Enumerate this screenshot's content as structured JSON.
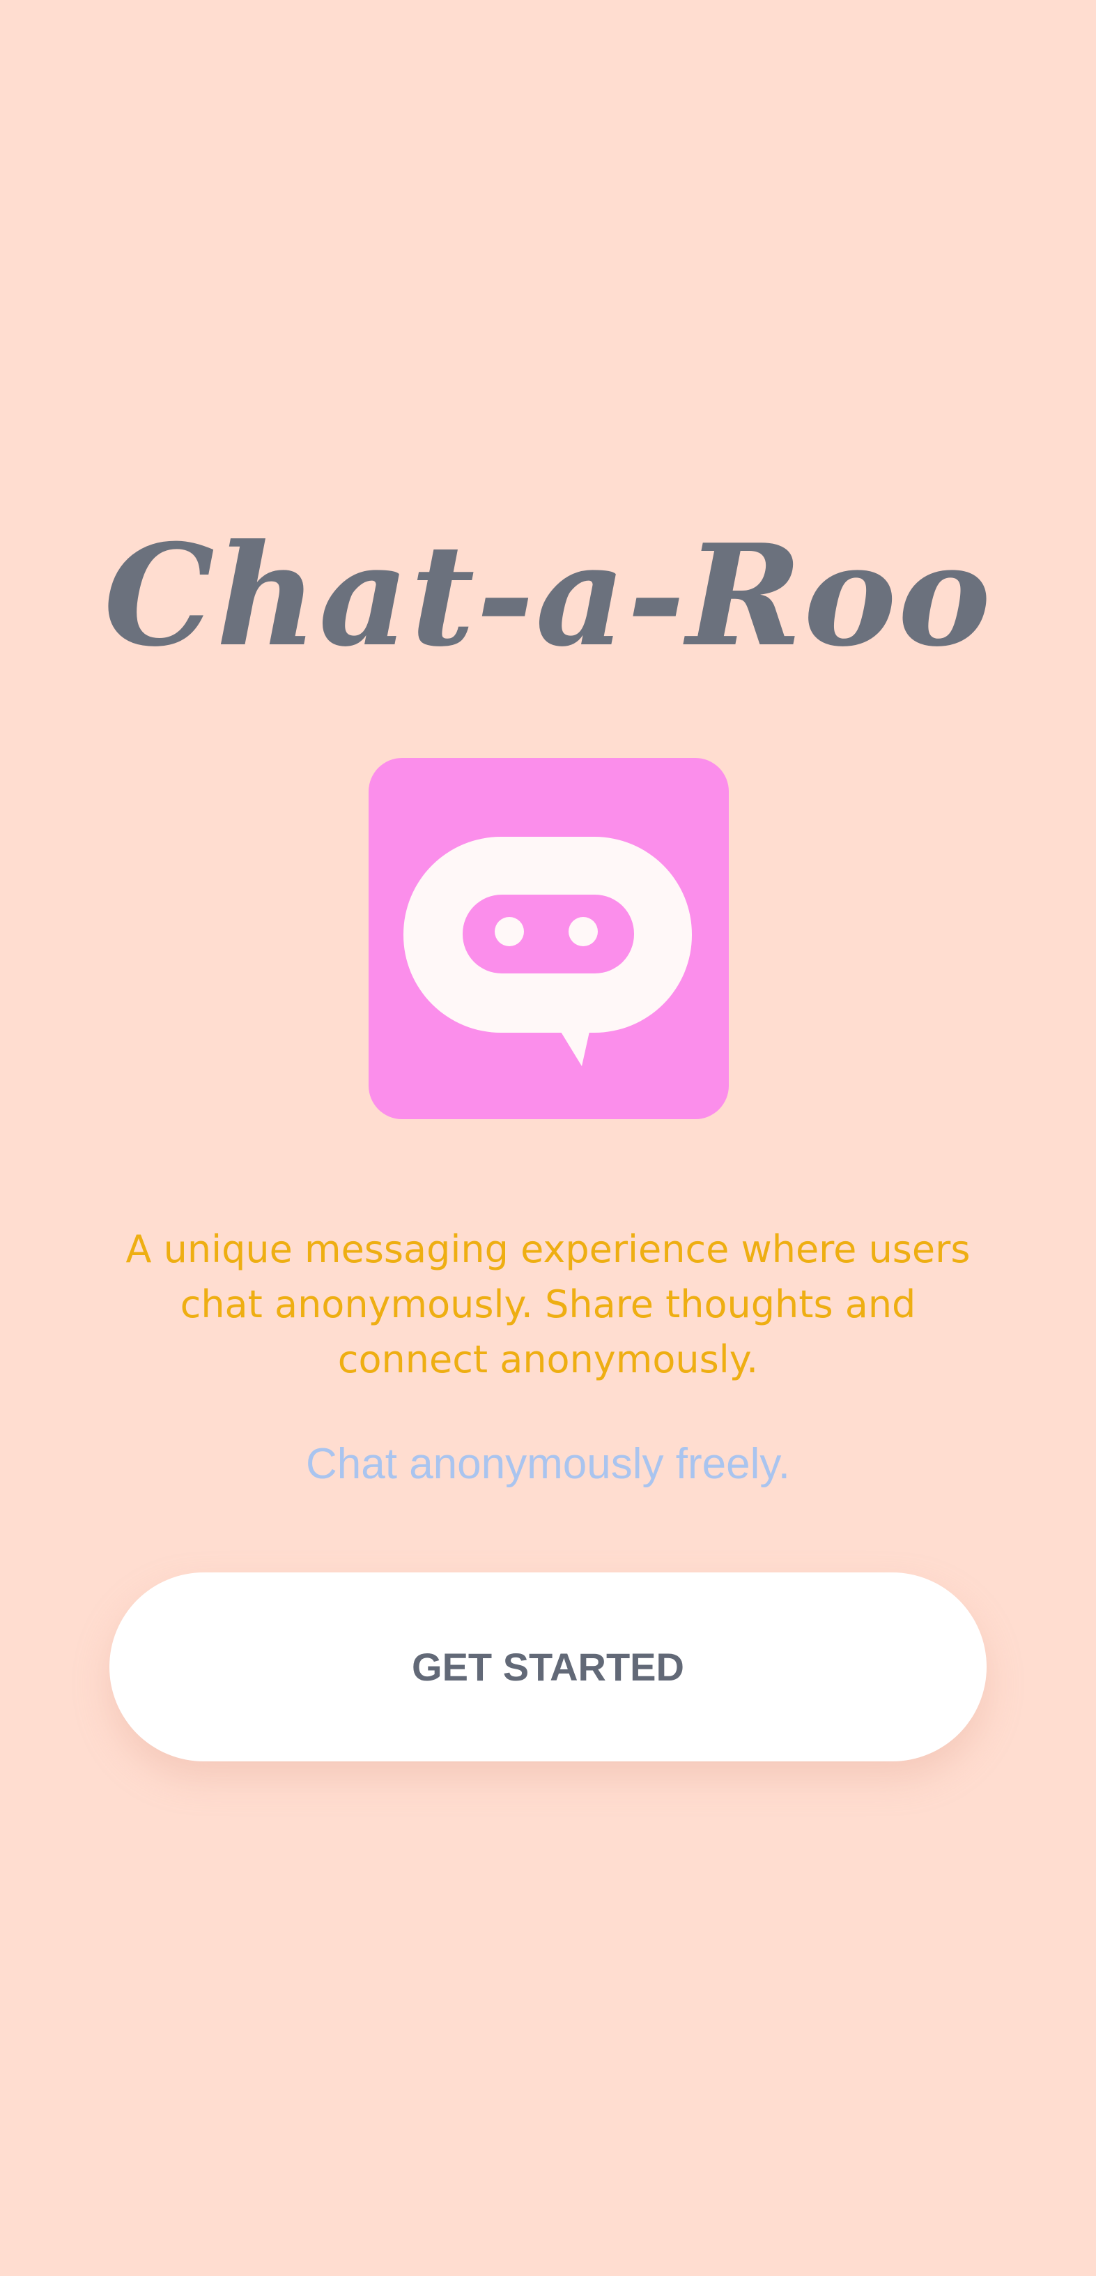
{
  "app": {
    "title": "Chat-a-Roo"
  },
  "logo": {
    "icon": "chat-bubble-robot-icon",
    "background_color": "#FB8EEB",
    "bubble_color": "#FFF8F8"
  },
  "intro": {
    "tagline": "A unique messaging experience where users chat anonymously. Share thoughts and connect anonymously.",
    "subtitle": "Chat anonymously freely."
  },
  "actions": {
    "get_started_label": "GET STARTED"
  },
  "colors": {
    "background": "#FFDDD0",
    "title": "#6B717D",
    "tagline": "#EEAE12",
    "subtitle": "#A9C4EF",
    "button_background": "#FFFFFF",
    "button_text": "#626977"
  }
}
